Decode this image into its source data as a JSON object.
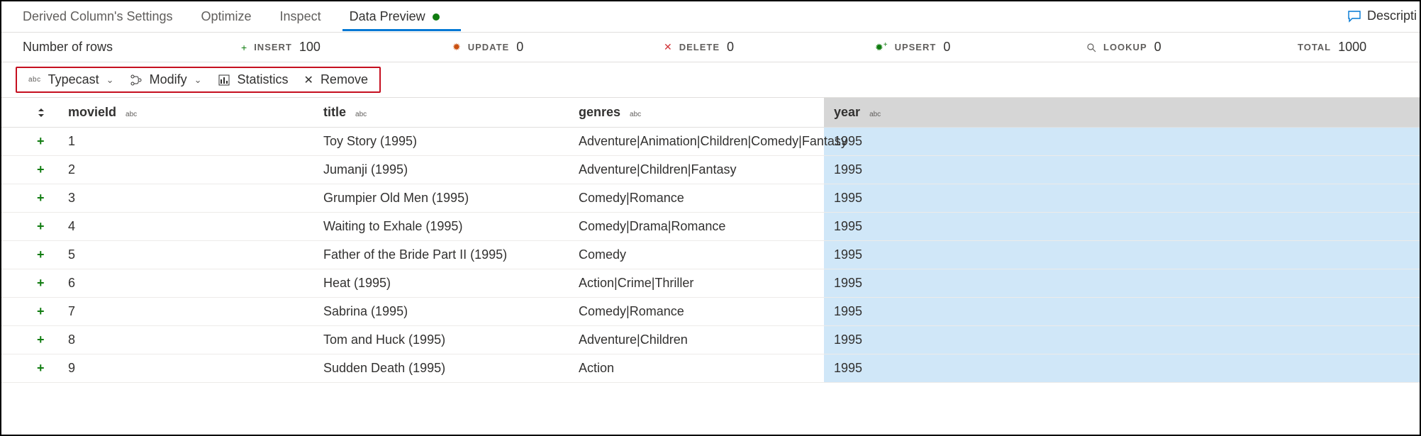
{
  "tabs": {
    "items": [
      {
        "label": "Derived Column's Settings"
      },
      {
        "label": "Optimize"
      },
      {
        "label": "Inspect"
      },
      {
        "label": "Data Preview"
      }
    ],
    "active_index": 3,
    "description_label": "Descripti"
  },
  "stats": {
    "rows_label": "Number of rows",
    "insert": {
      "name": "INSERT",
      "value": "100"
    },
    "update": {
      "name": "UPDATE",
      "value": "0"
    },
    "delete": {
      "name": "DELETE",
      "value": "0"
    },
    "upsert": {
      "name": "UPSERT",
      "value": "0"
    },
    "lookup": {
      "name": "LOOKUP",
      "value": "0"
    },
    "total": {
      "name": "TOTAL",
      "value": "1000"
    }
  },
  "toolbar": {
    "typecast": "Typecast",
    "modify": "Modify",
    "statistics": "Statistics",
    "remove": "Remove",
    "abc_badge": "abc"
  },
  "columns": {
    "movieId": {
      "label": "movieId",
      "type": "abc"
    },
    "title": {
      "label": "title",
      "type": "abc"
    },
    "genres": {
      "label": "genres",
      "type": "abc"
    },
    "year": {
      "label": "year",
      "type": "abc"
    }
  },
  "rows": [
    {
      "movieId": "1",
      "title": "Toy Story (1995)",
      "genres": "Adventure|Animation|Children|Comedy|Fantasy",
      "year": "1995"
    },
    {
      "movieId": "2",
      "title": "Jumanji (1995)",
      "genres": "Adventure|Children|Fantasy",
      "year": "1995"
    },
    {
      "movieId": "3",
      "title": "Grumpier Old Men (1995)",
      "genres": "Comedy|Romance",
      "year": "1995"
    },
    {
      "movieId": "4",
      "title": "Waiting to Exhale (1995)",
      "genres": "Comedy|Drama|Romance",
      "year": "1995"
    },
    {
      "movieId": "5",
      "title": "Father of the Bride Part II (1995)",
      "genres": "Comedy",
      "year": "1995"
    },
    {
      "movieId": "6",
      "title": "Heat (1995)",
      "genres": "Action|Crime|Thriller",
      "year": "1995"
    },
    {
      "movieId": "7",
      "title": "Sabrina (1995)",
      "genres": "Comedy|Romance",
      "year": "1995"
    },
    {
      "movieId": "8",
      "title": "Tom and Huck (1995)",
      "genres": "Adventure|Children",
      "year": "1995"
    },
    {
      "movieId": "9",
      "title": "Sudden Death (1995)",
      "genres": "Action",
      "year": "1995"
    }
  ]
}
